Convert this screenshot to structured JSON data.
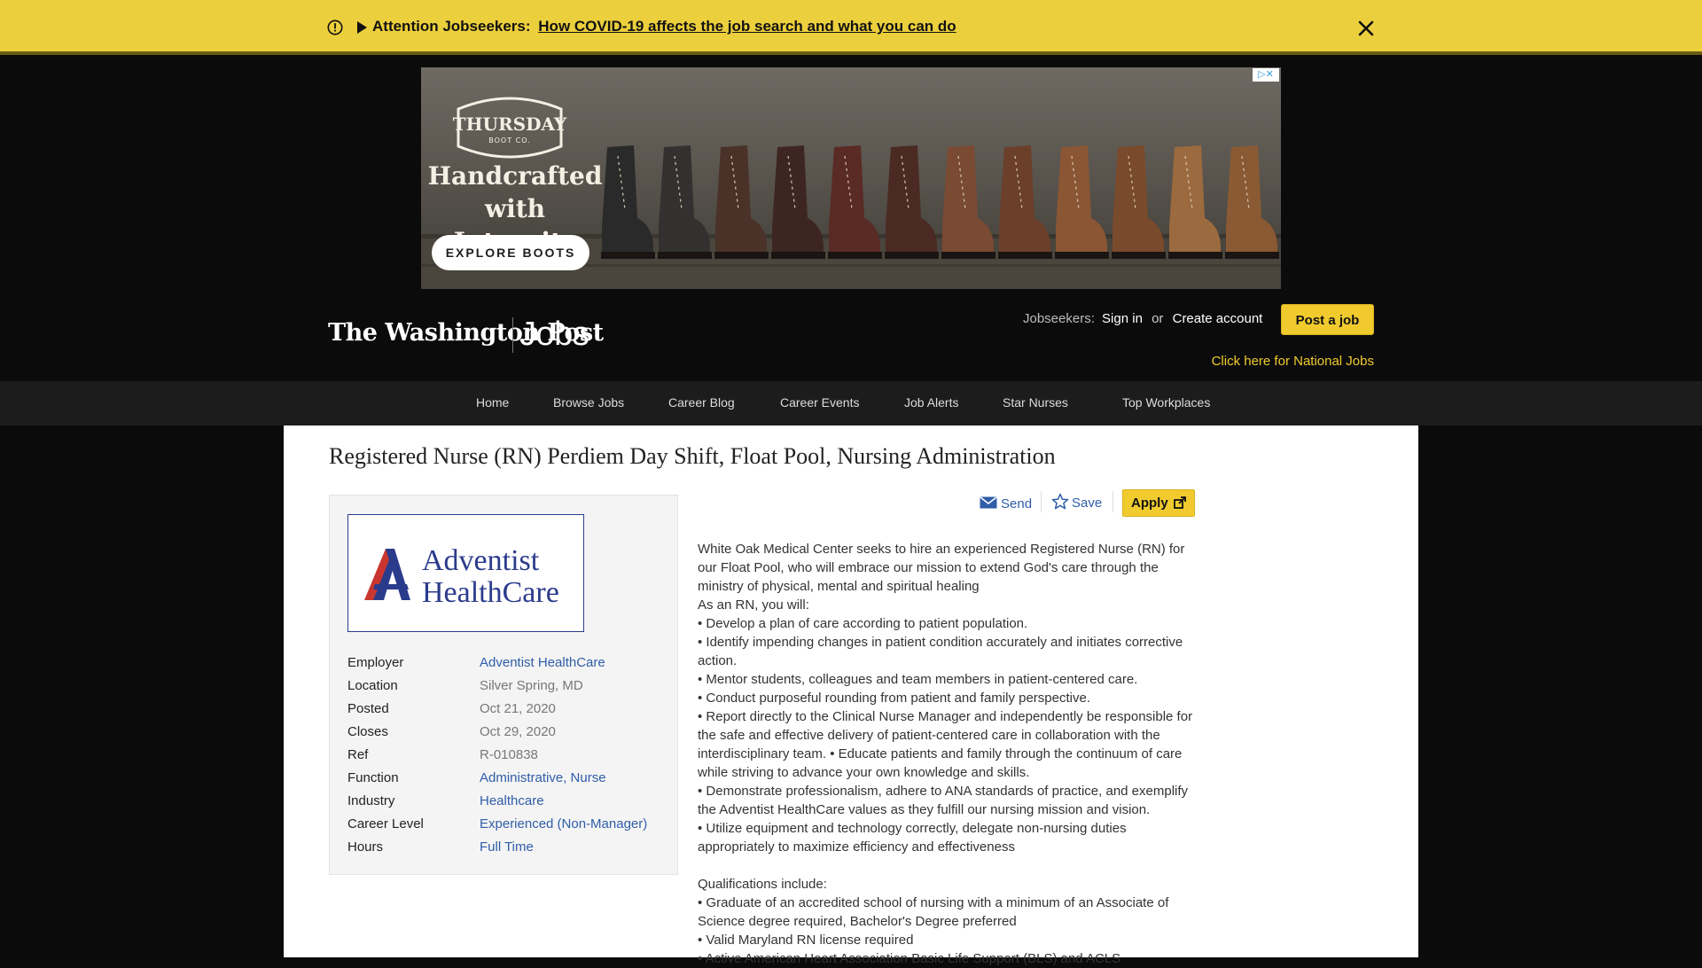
{
  "alert": {
    "prefix": "Attention Jobseekers:",
    "link_text": "How COVID-19 affects the job search and what you can do"
  },
  "ad": {
    "brand_line1": "THURSDAY",
    "brand_line2": "BOOT CO.",
    "headline_line1": "Handcrafted",
    "headline_line2": "with Integrity",
    "cta": "EXPLORE BOOTS"
  },
  "header": {
    "masthead": "The Washington Post",
    "section": "Jobs",
    "jobseekers_label": "Jobseekers:",
    "sign_in": "Sign in",
    "or": "or",
    "create_account": "Create account",
    "post_job": "Post a job",
    "national_jobs": "Click here for National Jobs"
  },
  "nav": {
    "items": [
      "Home",
      "Browse Jobs",
      "Career Blog",
      "Career Events",
      "Job Alerts",
      "Star Nurses",
      "Top Workplaces"
    ]
  },
  "job": {
    "title": "Registered Nurse (RN) Perdiem Day Shift, Float Pool, Nursing Administration",
    "employer_logo_line1": "Adventist",
    "employer_logo_line2": "HealthCare",
    "meta": {
      "employer_label": "Employer",
      "employer": "Adventist HealthCare",
      "location_label": "Location",
      "location": "Silver Spring, MD",
      "posted_label": "Posted",
      "posted": "Oct 21, 2020",
      "closes_label": "Closes",
      "closes": "Oct 29, 2020",
      "ref_label": "Ref",
      "ref": "R-010838",
      "function_label": "Function",
      "function_1": "Administrative",
      "function_sep": ", ",
      "function_2": "Nurse",
      "industry_label": "Industry",
      "industry": "Healthcare",
      "career_level_label": "Career Level",
      "career_level": "Experienced (Non-Manager)",
      "hours_label": "Hours",
      "hours": "Full Time"
    },
    "actions": {
      "send": "Send",
      "save": "Save",
      "apply": "Apply"
    },
    "description": [
      "White Oak Medical Center seeks to hire an experienced Registered Nurse (RN) for our Float Pool, who will embrace our mission to extend God's care through the ministry of physical, mental and spiritual healing",
      "As an RN, you will:",
      "• Develop a plan of care according to patient population.",
      "• Identify impending changes in patient condition accurately and initiates corrective action.",
      "• Mentor students, colleagues and team members in patient-centered care.",
      "• Conduct purposeful rounding from patient and family perspective.",
      "• Report directly to the Clinical Nurse Manager and independently be responsible for the safe and effective delivery of patient-centered care in collaboration with the interdisciplinary team. • Educate patients and family through the continuum of care while striving to advance your own knowledge and skills.",
      "• Demonstrate professionalism, adhere to ANA standards of practice, and exemplify the Adventist HealthCare values as they fulfill our nursing mission and vision.",
      "• Utilize equipment and technology correctly, delegate non-nursing duties appropriately to maximize efficiency and effectiveness"
    ],
    "qualifications": [
      "Qualifications include:",
      "• Graduate of an accredited school of nursing with a minimum of an Associate of Science degree required, Bachelor's Degree preferred",
      "• Valid Maryland RN license required",
      "• Active American Heart Association Basic Life Support (BLS) and ACLS"
    ]
  },
  "colors": {
    "alert_bg": "#eccf3c",
    "page_bg": "#0b0b0b",
    "accent_yellow": "#f1cb2e",
    "link_blue": "#2f5da8",
    "nav_bg": "#1c1c1c"
  }
}
